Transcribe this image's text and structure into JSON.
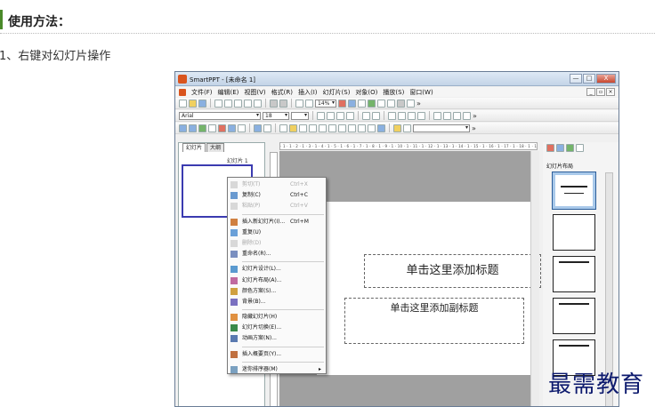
{
  "article": {
    "heading": "使用方法：",
    "step": "1、右键对幻灯片操作"
  },
  "window": {
    "title": "SmartPPT - [未命名 1]",
    "buttons": [
      "—",
      "□",
      "X"
    ]
  },
  "menubar": [
    "文件(F)",
    "编辑(E)",
    "视图(V)",
    "格式(R)",
    "插入(I)",
    "幻灯片(S)",
    "对象(O)",
    "播放(S)",
    "窗口(W)"
  ],
  "toolbar": {
    "zoom": "14%",
    "font_name": "Arial",
    "font_size": "18"
  },
  "left_pane": {
    "tabs": [
      "幻灯片",
      "大纲"
    ],
    "slide_label": "幻灯片 1"
  },
  "ruler": "· 1 · 1 · 2 · 1 · 3 · 1 · 4 · 1 · 5 · 1 · 6 · 1 · 7 · 1 · 8 · 1 · 9 · 1 · 10 · 1 · 11 · 1 · 12 · 1 · 13 · 1 · 14 · 1 · 15 · 1 · 16 · 1 · 17 · 1 · 18 · 1 · 19 · 1 · 20 · 1 · 21 · 1 · 22 · 1 · 23 · 1 · 24 · 1 · 25",
  "slide": {
    "title_placeholder": "单击这里添加标题",
    "subtitle_placeholder": "单击这里添加副标题"
  },
  "right_pane": {
    "title": "幻灯片布局"
  },
  "context_menu": [
    {
      "label": "剪切(T)",
      "shortcut": "Ctrl+X",
      "disabled": true
    },
    {
      "label": "复制(C)",
      "shortcut": "Ctrl+C",
      "disabled": false
    },
    {
      "label": "粘贴(P)",
      "shortcut": "Ctrl+V",
      "disabled": true
    },
    {
      "sep": true
    },
    {
      "label": "插入新幻灯片(I)...",
      "shortcut": "Ctrl+M",
      "disabled": false
    },
    {
      "label": "重复(U)",
      "shortcut": "",
      "disabled": false
    },
    {
      "label": "删除(D)",
      "shortcut": "",
      "disabled": true
    },
    {
      "label": "重命名(R)...",
      "shortcut": "",
      "disabled": false
    },
    {
      "sep": true
    },
    {
      "label": "幻灯片设计(L)...",
      "shortcut": "",
      "disabled": false
    },
    {
      "label": "幻灯片布局(A)...",
      "shortcut": "",
      "disabled": false
    },
    {
      "label": "颜色方案(S)...",
      "shortcut": "",
      "disabled": false
    },
    {
      "label": "背景(B)...",
      "shortcut": "",
      "disabled": false
    },
    {
      "sep": true
    },
    {
      "label": "隐藏幻灯片(H)",
      "shortcut": "",
      "disabled": false
    },
    {
      "label": "幻灯片切换(E)...",
      "shortcut": "",
      "disabled": false
    },
    {
      "label": "动画方案(N)...",
      "shortcut": "",
      "disabled": false
    },
    {
      "sep": true
    },
    {
      "label": "插入概要页(Y)...",
      "shortcut": "",
      "disabled": false
    },
    {
      "sep": true
    },
    {
      "label": "迷你排序器(M)",
      "shortcut": "",
      "disabled": false,
      "submenu": true
    }
  ],
  "watermark": "最需教育"
}
